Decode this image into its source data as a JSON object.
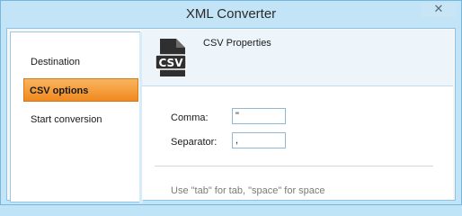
{
  "window": {
    "title": "XML Converter",
    "close_glyph": "✕"
  },
  "sidebar": {
    "items": [
      {
        "label": "Destination",
        "active": false
      },
      {
        "label": "CSV options",
        "active": true
      },
      {
        "label": "Start conversion",
        "active": false
      }
    ]
  },
  "panel": {
    "icon": "csv-file-icon",
    "icon_text": "CSV",
    "title": "CSV Properties",
    "fields": {
      "comma": {
        "label": "Comma:",
        "value": "\""
      },
      "separator": {
        "label": "Separator:",
        "value": ","
      }
    },
    "hint": "Use \"tab\" for tab, \"space\" for space"
  },
  "colors": {
    "active_item": "#f39a2e",
    "window_frame": "#c3e3f6",
    "accent_blue": "#74b7e0"
  }
}
